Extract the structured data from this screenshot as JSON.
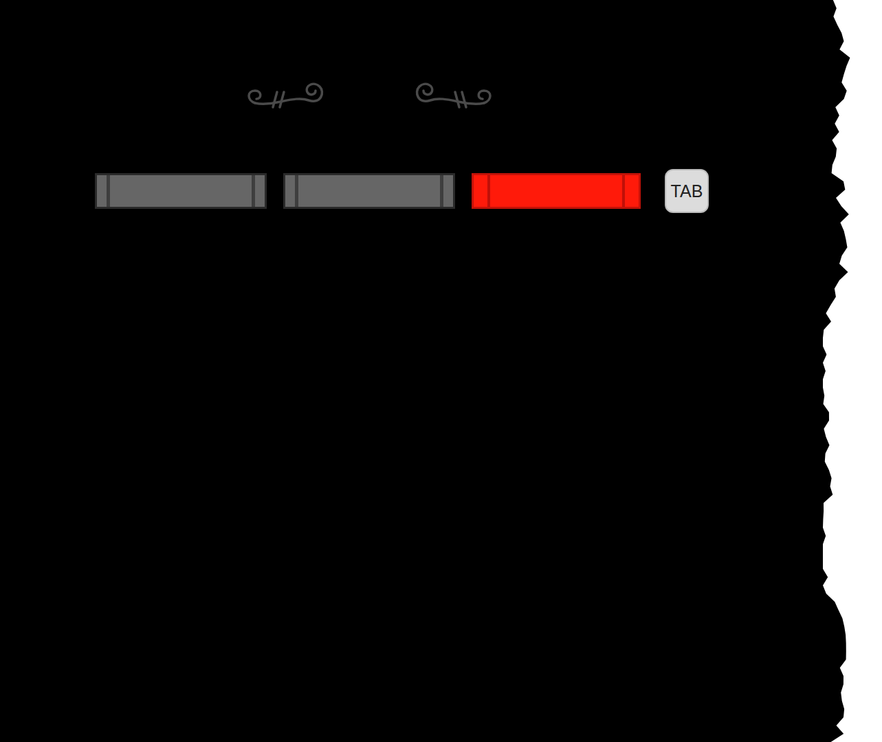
{
  "bars": [
    {
      "selected": false
    },
    {
      "selected": false
    },
    {
      "selected": true
    }
  ],
  "tab_key": {
    "label": "TAB"
  }
}
